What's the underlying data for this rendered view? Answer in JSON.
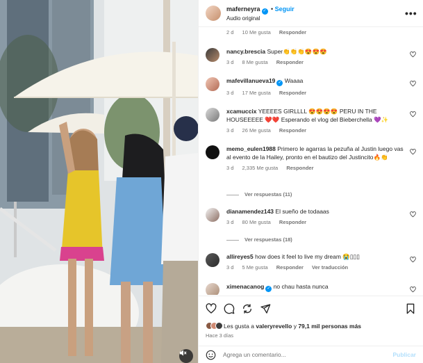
{
  "header": {
    "username": "maferneyra",
    "follow_label": "Seguir",
    "audio": "Audio original",
    "more_icon": "more-horizontal-icon"
  },
  "comments": [
    {
      "time": "2 d",
      "likes": "10 Me gusta",
      "reply": "Responder"
    },
    {
      "user": "nancy.brescia",
      "text": "Super👏👏👏😍😍😍",
      "time": "3 d",
      "likes": "8 Me gusta",
      "reply": "Responder"
    },
    {
      "user": "mafevillanueva19",
      "text": "Waaaa",
      "time": "3 d",
      "likes": "17 Me gusta",
      "reply": "Responder"
    },
    {
      "user": "xcamuccix",
      "text": "YEEEES GIRLLLL 😍😍😍😍 PERU IN THE HOUSEEEEE ❤️❤️ Esperando el vlog del Bieberchella 💜✨",
      "time": "3 d",
      "likes": "26 Me gusta",
      "reply": "Responder"
    },
    {
      "user": "memo_eulen1988",
      "text": "Primero le agarras la pezuña al Justin luego vas al evento de la Hailey, pronto en el bautizo del Justincito🔥👏",
      "time": "3 d",
      "likes": "2,335 Me gusta",
      "reply": "Responder",
      "replies": "Ver respuestas (11)"
    },
    {
      "user": "dianamendez143",
      "text": "El sueño de todaaas",
      "time": "3 d",
      "likes": "80 Me gusta",
      "reply": "Responder",
      "replies": "Ver respuestas (18)"
    },
    {
      "user": "allireyes5",
      "text": "how does it feel to live my dream 😭▯▯▯",
      "time": "3 d",
      "likes": "5 Me gusta",
      "reply": "Responder",
      "translate": "Ver traducción"
    },
    {
      "user": "ximenacanog",
      "text": "no chau hasta nunca"
    }
  ],
  "actions": {
    "liked_by_prefix": "Les gusta a",
    "liked_by_user": "valeryrevello",
    "liked_by_joiner": "y",
    "liked_by_others": "79,1 mil personas más",
    "time_ago": "Hace 3 días"
  },
  "composer": {
    "placeholder": "Agrega un comentario...",
    "publish_label": "Publicar"
  },
  "colors": {
    "accent": "#0095f6",
    "publish_disabled": "#b2dffc",
    "muted": "#737373"
  }
}
